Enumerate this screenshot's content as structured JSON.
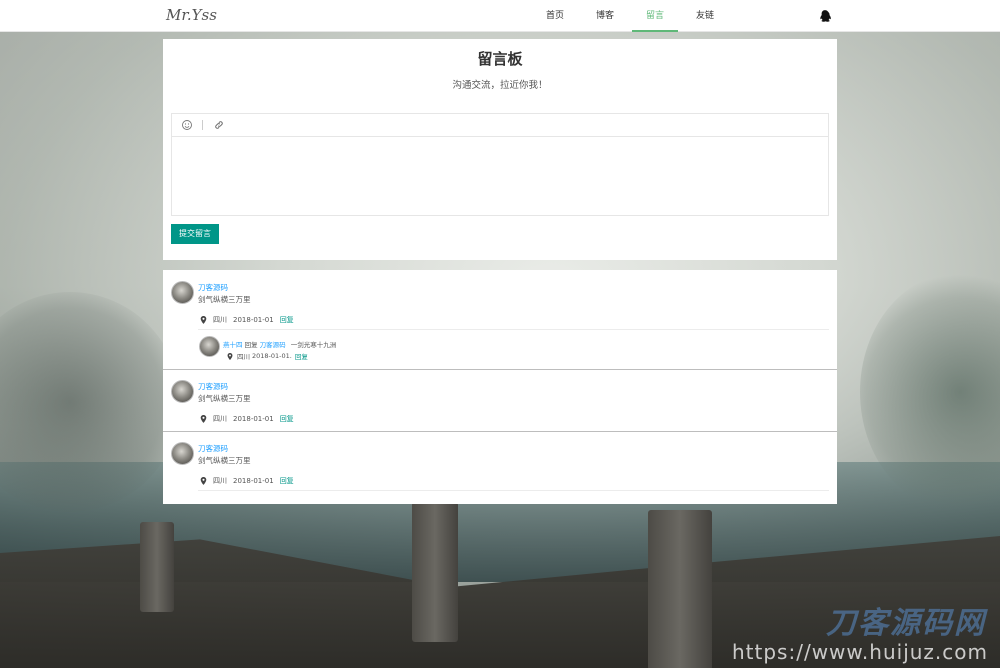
{
  "nav": {
    "logo": "Mr.Yss",
    "items": [
      {
        "label": "首页"
      },
      {
        "label": "博客"
      },
      {
        "label": "留言"
      },
      {
        "label": "友链"
      }
    ],
    "active_index": 2,
    "right_icon": "qq-penguin-icon",
    "accent_color": "#5fb878"
  },
  "board": {
    "title": "留言板",
    "subtitle": "沟通交流，拉近你我！",
    "toolbar_icons": [
      "emoji-icon",
      "link-icon"
    ],
    "editor_value": "",
    "submit_label": "提交留言",
    "submit_color": "#009688"
  },
  "comments": [
    {
      "author": "刀客源码",
      "text": "剑气纵横三万里",
      "location": "四川",
      "date": "2018-01-01",
      "reply_label": "回复",
      "replies": [
        {
          "author": "燕十四",
          "verb": "回复",
          "target": "刀客源码",
          "text": "一剑光寒十九洲",
          "location": "四川",
          "date": "2018-01-01.",
          "reply_label": "回复"
        }
      ]
    },
    {
      "author": "刀客源码",
      "text": "剑气纵横三万里",
      "location": "四川",
      "date": "2018-01-01",
      "reply_label": "回复"
    },
    {
      "author": "刀客源码",
      "text": "剑气纵横三万里",
      "location": "四川",
      "date": "2018-01-01",
      "reply_label": "回复"
    }
  ],
  "watermark": {
    "brand": "刀客源码网",
    "url": "https://www.huijuz.com"
  }
}
